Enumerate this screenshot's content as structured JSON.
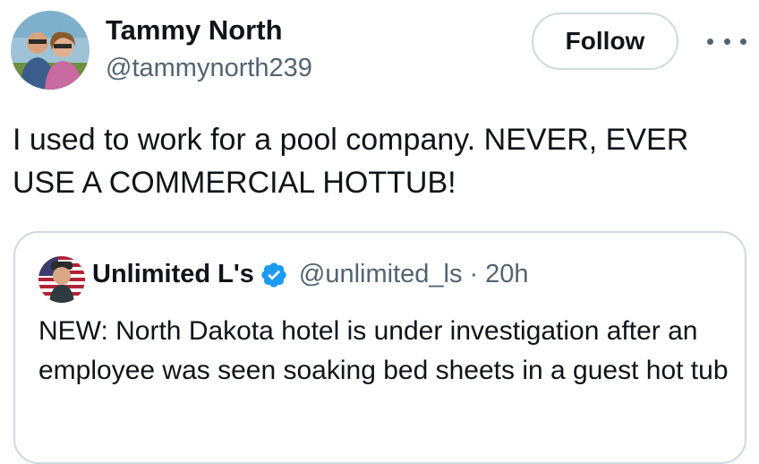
{
  "tweet": {
    "author": {
      "name": "Tammy North",
      "handle": "@tammynorth239",
      "avatar": "couple-photo-avatar"
    },
    "follow_label": "Follow",
    "more_icon": "more-horizontal-icon",
    "text": "I used to work for a pool company. NEVER, EVER USE A COMMERCIAL HOTTUB!"
  },
  "quote": {
    "author": {
      "name": "Unlimited L's",
      "handle": "@unlimited_ls",
      "avatar": "man-flag-avatar",
      "verified_icon": "verified-badge-icon"
    },
    "separator": "·",
    "time": "20h",
    "text": "NEW: North Dakota hotel is under investigation after an employee was seen soaking bed sheets in a guest hot tub"
  },
  "colors": {
    "text_primary": "#0f1419",
    "text_secondary": "#536471",
    "border": "#cfd9de",
    "verified_blue": "#1d9bf0"
  }
}
